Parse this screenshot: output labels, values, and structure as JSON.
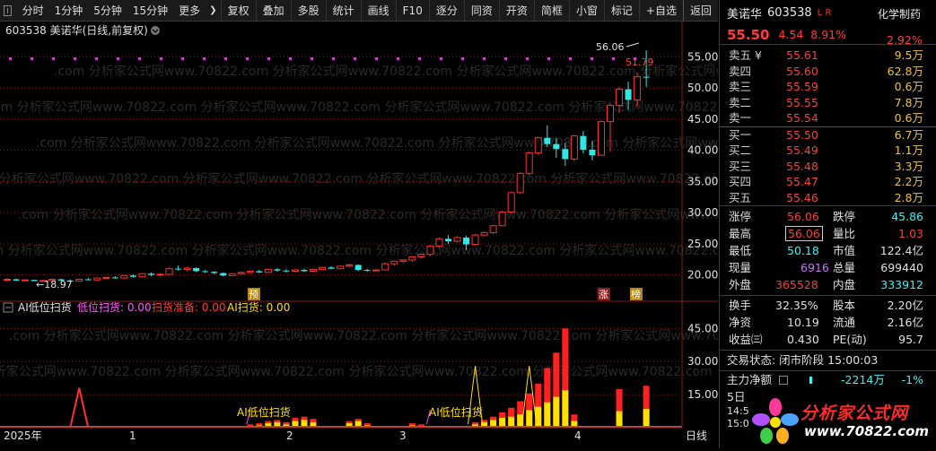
{
  "toolbar": {
    "periods": [
      "分时",
      "1分钟",
      "5分钟",
      "15分钟",
      "更多"
    ],
    "buttons": [
      "复权",
      "叠加",
      "多股",
      "统计",
      "画线",
      "F10",
      "逐分",
      "同资",
      "开资",
      "简框",
      "小窗",
      "标记",
      "+自选",
      "返回"
    ]
  },
  "chart": {
    "title": "603538  美诺华(日线,前复权)",
    "watermark": ".com 分析家公式网www.70822.com 分析家公式网www.70822.com 分析家公式网www.70822.com 分析家公式网www.70822.com",
    "high_label": "56.06",
    "close_label": "51.79",
    "low_label": "←18.97",
    "markers": [
      "预",
      "涨",
      "榜"
    ],
    "indicator_line": {
      "name": "AI低位扫货",
      "low_label": "低位扫货: 0.00",
      "prep_label": "扫货准备: 0.00",
      "ai_label": "AI扫货: 0.00"
    },
    "ai_signal_label": "AI低位扫货",
    "x_labels": [
      "2025年",
      "1",
      "2",
      "3",
      "4"
    ],
    "x_right_label": "日线",
    "colors": {
      "up": "#ff3030",
      "down": "#33e6e6",
      "grid": "#8b1a1a",
      "yellow": "#ffe000"
    }
  },
  "chart_data": [
    {
      "type": "candlestick",
      "title": "603538  美诺华(日线,前复权)",
      "ylim": [
        17.5,
        57.5
      ],
      "y_ticks": [
        20.0,
        25.0,
        30.0,
        35.0,
        40.0,
        45.0,
        50.0,
        55.0
      ],
      "x_labels": [
        "2025年",
        "1",
        "2",
        "3",
        "4"
      ],
      "candles": [
        [
          19.2,
          19.5,
          19.0,
          19.3
        ],
        [
          19.3,
          19.4,
          18.97,
          19.1
        ],
        [
          19.1,
          19.3,
          19.0,
          19.2
        ],
        [
          19.2,
          19.2,
          18.98,
          19.0
        ],
        [
          19.0,
          19.2,
          19.0,
          19.1
        ],
        [
          19.1,
          19.4,
          19.0,
          19.3
        ],
        [
          19.3,
          19.4,
          19.0,
          19.1
        ],
        [
          19.1,
          19.3,
          19.0,
          19.0
        ],
        [
          19.0,
          19.4,
          19.0,
          19.3
        ],
        [
          19.3,
          19.5,
          19.1,
          19.2
        ],
        [
          19.2,
          19.6,
          19.1,
          19.5
        ],
        [
          19.5,
          19.7,
          19.4,
          19.6
        ],
        [
          19.6,
          19.8,
          19.4,
          19.5
        ],
        [
          19.5,
          20.0,
          19.4,
          19.9
        ],
        [
          19.9,
          20.1,
          19.6,
          19.7
        ],
        [
          19.7,
          20.3,
          19.6,
          20.2
        ],
        [
          20.2,
          20.4,
          19.8,
          20.0
        ],
        [
          20.0,
          20.3,
          19.8,
          20.1
        ],
        [
          20.1,
          21.2,
          20.0,
          21.0
        ],
        [
          21.0,
          21.5,
          20.7,
          20.9
        ],
        [
          20.9,
          21.3,
          20.6,
          21.1
        ],
        [
          21.1,
          21.2,
          20.5,
          20.6
        ],
        [
          20.6,
          20.8,
          20.3,
          20.5
        ],
        [
          20.5,
          20.6,
          20.1,
          20.3
        ],
        [
          20.3,
          20.4,
          19.8,
          19.9
        ],
        [
          19.9,
          20.3,
          19.8,
          20.2
        ],
        [
          20.2,
          20.5,
          20.1,
          20.4
        ],
        [
          20.4,
          20.7,
          20.2,
          20.6
        ],
        [
          20.6,
          20.8,
          20.3,
          20.4
        ],
        [
          20.4,
          21.0,
          20.3,
          20.9
        ],
        [
          20.9,
          21.1,
          20.5,
          20.7
        ],
        [
          20.7,
          20.9,
          20.4,
          20.6
        ],
        [
          20.6,
          20.9,
          20.5,
          20.8
        ],
        [
          20.8,
          21.0,
          20.5,
          20.6
        ],
        [
          20.6,
          21.0,
          20.5,
          20.9
        ],
        [
          20.9,
          21.3,
          20.8,
          21.2
        ],
        [
          21.2,
          21.4,
          20.9,
          21.0
        ],
        [
          21.0,
          21.5,
          20.9,
          21.4
        ],
        [
          21.4,
          21.8,
          21.2,
          21.6
        ],
        [
          21.6,
          21.7,
          20.6,
          20.8
        ],
        [
          20.8,
          21.0,
          20.5,
          20.7
        ],
        [
          20.7,
          20.9,
          20.6,
          20.8
        ],
        [
          20.8,
          22.0,
          20.7,
          21.8
        ],
        [
          21.8,
          22.3,
          21.5,
          22.2
        ],
        [
          22.2,
          22.5,
          21.9,
          22.4
        ],
        [
          22.4,
          23.0,
          22.1,
          22.9
        ],
        [
          22.9,
          23.4,
          22.6,
          23.3
        ],
        [
          23.3,
          24.8,
          23.0,
          24.6
        ],
        [
          24.6,
          26.0,
          24.3,
          25.8
        ],
        [
          25.8,
          26.4,
          25.0,
          25.4
        ],
        [
          25.4,
          26.2,
          25.2,
          26.0
        ],
        [
          26.0,
          26.3,
          24.0,
          24.9
        ],
        [
          24.9,
          26.6,
          24.7,
          26.4
        ],
        [
          26.4,
          26.9,
          26.2,
          26.8
        ],
        [
          26.8,
          28.0,
          26.5,
          27.9
        ],
        [
          27.9,
          30.3,
          27.8,
          30.1
        ],
        [
          30.1,
          33.4,
          29.9,
          33.2
        ],
        [
          33.2,
          36.5,
          33.0,
          36.3
        ],
        [
          36.3,
          39.8,
          36.0,
          39.6
        ],
        [
          39.6,
          42.2,
          39.3,
          42.0
        ],
        [
          42.0,
          44.0,
          40.5,
          41.0
        ],
        [
          41.0,
          42.0,
          38.8,
          40.2
        ],
        [
          40.2,
          41.2,
          37.5,
          38.6
        ],
        [
          38.6,
          42.5,
          38.3,
          42.3
        ],
        [
          42.3,
          43.1,
          39.5,
          40.1
        ],
        [
          40.1,
          41.5,
          38.4,
          39.2
        ],
        [
          39.2,
          44.8,
          39.2,
          44.6
        ],
        [
          44.6,
          47.5,
          39.8,
          47.2
        ],
        [
          47.2,
          50.2,
          46.0,
          49.8
        ],
        [
          49.8,
          51.0,
          46.5,
          48.1
        ],
        [
          48.1,
          52.5,
          47.0,
          51.8
        ],
        [
          51.8,
          56.06,
          50.18,
          51.79
        ]
      ]
    },
    {
      "type": "bar",
      "title": "AI低位扫货",
      "ylim": [
        0,
        50
      ],
      "y_ticks": [
        15.0,
        30.0,
        45.0
      ],
      "series": [
        {
          "name": "低位扫货",
          "color": "#ff2020"
        },
        {
          "name": "扫货准备",
          "color": "#ff3b3b"
        },
        {
          "name": "AI扫货",
          "color": "#ffe000"
        }
      ],
      "bars": [
        {
          "x": 27,
          "red": 1.5,
          "yellow": 0.5
        },
        {
          "x": 28,
          "red": 2.0,
          "yellow": 1.0
        },
        {
          "x": 29,
          "red": 3.0,
          "yellow": 2.0
        },
        {
          "x": 30,
          "red": 3.5,
          "yellow": 2.5
        },
        {
          "x": 31,
          "red": 2.5,
          "yellow": 1.5
        },
        {
          "x": 32,
          "red": 4.5,
          "yellow": 3.0
        },
        {
          "x": 33,
          "red": 5.0,
          "yellow": 3.5
        },
        {
          "x": 34,
          "red": 4.0,
          "yellow": 2.5
        },
        {
          "x": 38,
          "red": 3.0,
          "yellow": 2.0
        },
        {
          "x": 39,
          "red": 4.0,
          "yellow": 3.0
        },
        {
          "x": 40,
          "red": 2.0,
          "yellow": 1.0
        },
        {
          "x": 45,
          "red": 2.0,
          "yellow": 1.0
        },
        {
          "x": 46,
          "red": 1.5,
          "yellow": 0.5
        },
        {
          "x": 52,
          "red": 2.5,
          "yellow": 1.5
        },
        {
          "x": 53,
          "red": 3.5,
          "yellow": 2.5
        },
        {
          "x": 54,
          "red": 5.0,
          "yellow": 3.5
        },
        {
          "x": 55,
          "red": 7.0,
          "yellow": 4.5
        },
        {
          "x": 56,
          "red": 9.0,
          "yellow": 5.0
        },
        {
          "x": 57,
          "red": 12.0,
          "yellow": 6.0
        },
        {
          "x": 58,
          "red": 15.5,
          "yellow": 8.0
        },
        {
          "x": 59,
          "red": 20.0,
          "yellow": 9.5
        },
        {
          "x": 60,
          "red": 27.0,
          "yellow": 11.5
        },
        {
          "x": 61,
          "red": 34.0,
          "yellow": 14.0
        },
        {
          "x": 62,
          "red": 45.0,
          "yellow": 17.0
        },
        {
          "x": 63,
          "red": 6.0,
          "yellow": 3.0
        },
        {
          "x": 68,
          "red": 17.5,
          "yellow": 7.5
        },
        {
          "x": 71,
          "red": 19.0,
          "yellow": 8.5
        }
      ],
      "spike_x": 8,
      "spike_value": 18.0
    }
  ],
  "quote": {
    "name": "美诺华",
    "code": "603538",
    "lr": "L R",
    "industry": "化学制药",
    "price": "55.50",
    "change": "4.54",
    "pct": "8.91%",
    "industry_pct": "2.92%",
    "asks": [
      {
        "label": "卖五 ¥",
        "price": "55.61",
        "vol": "9.5万"
      },
      {
        "label": "卖四",
        "price": "55.60",
        "vol": "62.8万"
      },
      {
        "label": "卖三",
        "price": "55.59",
        "vol": "0.6万"
      },
      {
        "label": "卖二",
        "price": "55.55",
        "vol": "7.8万"
      },
      {
        "label": "卖一",
        "price": "55.54",
        "vol": "0.6万"
      }
    ],
    "bids": [
      {
        "label": "买一",
        "price": "55.50",
        "vol": "6.7万"
      },
      {
        "label": "买二",
        "price": "55.49",
        "vol": "1.1万"
      },
      {
        "label": "买三",
        "price": "55.48",
        "vol": "3.3万"
      },
      {
        "label": "买四",
        "price": "55.47",
        "vol": "2.2万"
      },
      {
        "label": "买五",
        "price": "55.46",
        "vol": "2.8万"
      }
    ],
    "stats": {
      "zt_l": "涨停",
      "zt_v": "56.06",
      "dt_l": "跌停",
      "dt_v": "45.86",
      "high_l": "最高",
      "high_v": "56.06",
      "lb_l": "量比",
      "lb_v": "1.03",
      "low_l": "最低",
      "low_v": "50.18",
      "mv_l": "市值",
      "mv_v": "122.4亿",
      "now_l": "现量",
      "now_v": "6916",
      "vol_l": "总量",
      "vol_v": "699440",
      "out_l": "外盘",
      "out_v": "365528",
      "in_l": "内盘",
      "in_v": "333912",
      "hs_l": "换手",
      "hs_v": "32.35%",
      "gb_l": "股本",
      "gb_v": "2.20亿",
      "jz_l": "净资",
      "jz_v": "10.19",
      "lt_l": "流通",
      "lt_v": "2.16亿",
      "sy_l": "收益㈢",
      "sy_v": "0.430",
      "pe_l": "PE(动)",
      "pe_v": "95.7"
    },
    "trade_status": "交易状态: 闭市阶段 15:00:03",
    "main_flow_label": "主力净额",
    "main_flow_value": "-2214万",
    "main_flow_pct": "-1%",
    "day_label": "5日",
    "time1": "14:5",
    "time2": "15:0"
  },
  "logo": {
    "text": "分析家公式网",
    "url": "www.70822.com"
  }
}
